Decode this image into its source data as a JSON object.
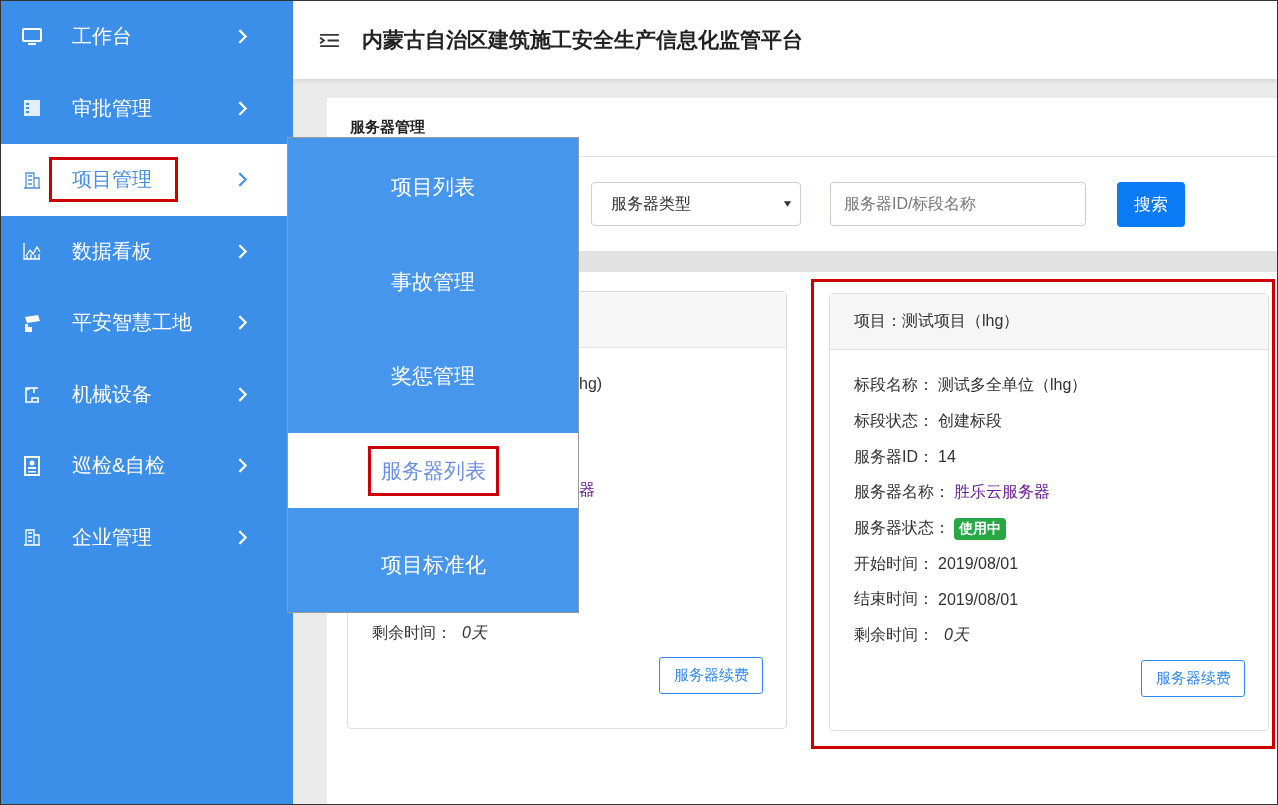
{
  "sidebar": {
    "items": [
      {
        "label": "工作台",
        "selected": false,
        "highlighted": false
      },
      {
        "label": "审批管理",
        "selected": false,
        "highlighted": false
      },
      {
        "label": "项目管理",
        "selected": true,
        "highlighted": true
      },
      {
        "label": "数据看板",
        "selected": false,
        "highlighted": false
      },
      {
        "label": "平安智慧工地",
        "selected": false,
        "highlighted": false
      },
      {
        "label": "机械设备",
        "selected": false,
        "highlighted": false
      },
      {
        "label": "巡检&自检",
        "selected": false,
        "highlighted": false
      },
      {
        "label": "企业管理",
        "selected": false,
        "highlighted": false
      }
    ]
  },
  "header": {
    "title": "内蒙古自治区建筑施工安全生产信息化监管平台"
  },
  "submenu": {
    "items": [
      {
        "label": "项目列表",
        "selected": false,
        "highlighted": false
      },
      {
        "label": "事故管理",
        "selected": false,
        "highlighted": false
      },
      {
        "label": "奖惩管理",
        "selected": false,
        "highlighted": false
      },
      {
        "label": "服务器列表",
        "selected": true,
        "highlighted": true
      },
      {
        "label": "项目标准化",
        "selected": false,
        "highlighted": false
      }
    ]
  },
  "panel": {
    "title": "服务器管理",
    "type_select": {
      "value": "服务器类型"
    },
    "search": {
      "placeholder": "服务器ID/标段名称"
    },
    "search_button": "搜索",
    "cards": [
      {
        "highlighted": false,
        "rows": [
          {
            "kind": "text",
            "value": "hg)"
          },
          {
            "kind": "link",
            "value": "器"
          },
          {
            "kind": "italic",
            "label": "剩余时间：",
            "value": "0天"
          }
        ],
        "button": "服务器续费"
      },
      {
        "highlighted": true,
        "header": "项目：测试项目（lhg）",
        "rows": [
          {
            "kind": "text",
            "label": "标段名称：",
            "value": "测试多全单位（lhg）"
          },
          {
            "kind": "text",
            "label": "标段状态：",
            "value": "创建标段"
          },
          {
            "kind": "text",
            "label": "服务器ID：",
            "value": "14"
          },
          {
            "kind": "link",
            "label": "服务器名称：",
            "value": "胜乐云服务器"
          },
          {
            "kind": "badge",
            "label": "服务器状态：",
            "value": "使用中"
          },
          {
            "kind": "text",
            "label": "开始时间：",
            "value": "2019/08/01"
          },
          {
            "kind": "text",
            "label": "结束时间：",
            "value": "2019/08/01"
          },
          {
            "kind": "italic",
            "label": "剩余时间：",
            "value": "0天"
          }
        ],
        "button": "服务器续费"
      }
    ]
  }
}
